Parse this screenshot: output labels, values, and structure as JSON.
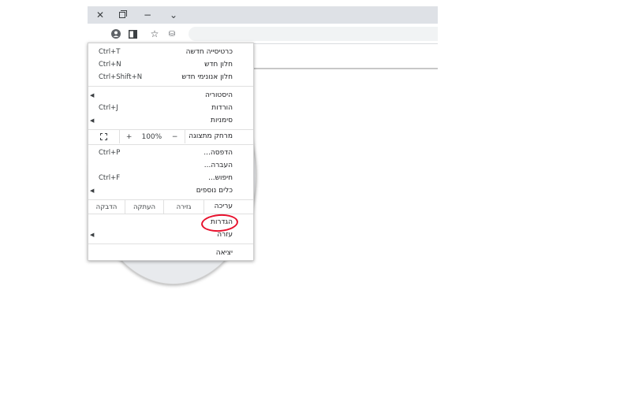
{
  "window": {
    "close_glyph": "✕",
    "minimize_glyph": "−",
    "tab_search_glyph": "⌄"
  },
  "toolbar": {
    "icons": [
      "menu-dots-icon",
      "profile-icon",
      "side-panel-icon",
      "star-icon",
      "reader-mode-icon"
    ],
    "star_glyph": "☆",
    "reader_glyph": "⛁"
  },
  "menu": {
    "new_tab": {
      "label": "כרטיסייה חדשה",
      "shortcut": "Ctrl+T"
    },
    "new_window": {
      "label": "חלון חדש",
      "shortcut": "Ctrl+N"
    },
    "new_incognito": {
      "label": "חלון אנונימי חדש",
      "shortcut": "Ctrl+Shift+N"
    },
    "history": {
      "label": "היסטוריה",
      "arrow": "◀"
    },
    "downloads": {
      "label": "הורדות",
      "shortcut": "Ctrl+J"
    },
    "bookmarks": {
      "label": "סימניות",
      "arrow": "◀"
    },
    "zoom": {
      "label": "מרחק מתצוגה",
      "minus": "−",
      "value": "100%",
      "plus": "+"
    },
    "print": {
      "label": "הדפסה...",
      "shortcut": "Ctrl+P"
    },
    "cast": {
      "label": "העברה..."
    },
    "find": {
      "label": "חיפוש...",
      "shortcut": "Ctrl+F"
    },
    "more_tools": {
      "label": "כלים נוספים",
      "arrow": "◀"
    },
    "edit": {
      "label": "עריכה",
      "cut": "גזירה",
      "copy": "העתקה",
      "paste": "הדבקה"
    },
    "settings": {
      "label": "הגדרות"
    },
    "help": {
      "label": "עזרה",
      "arrow": "◀"
    },
    "exit": {
      "label": "יציאה"
    }
  },
  "annotation": {
    "color": "#e8112d",
    "target": "settings"
  }
}
